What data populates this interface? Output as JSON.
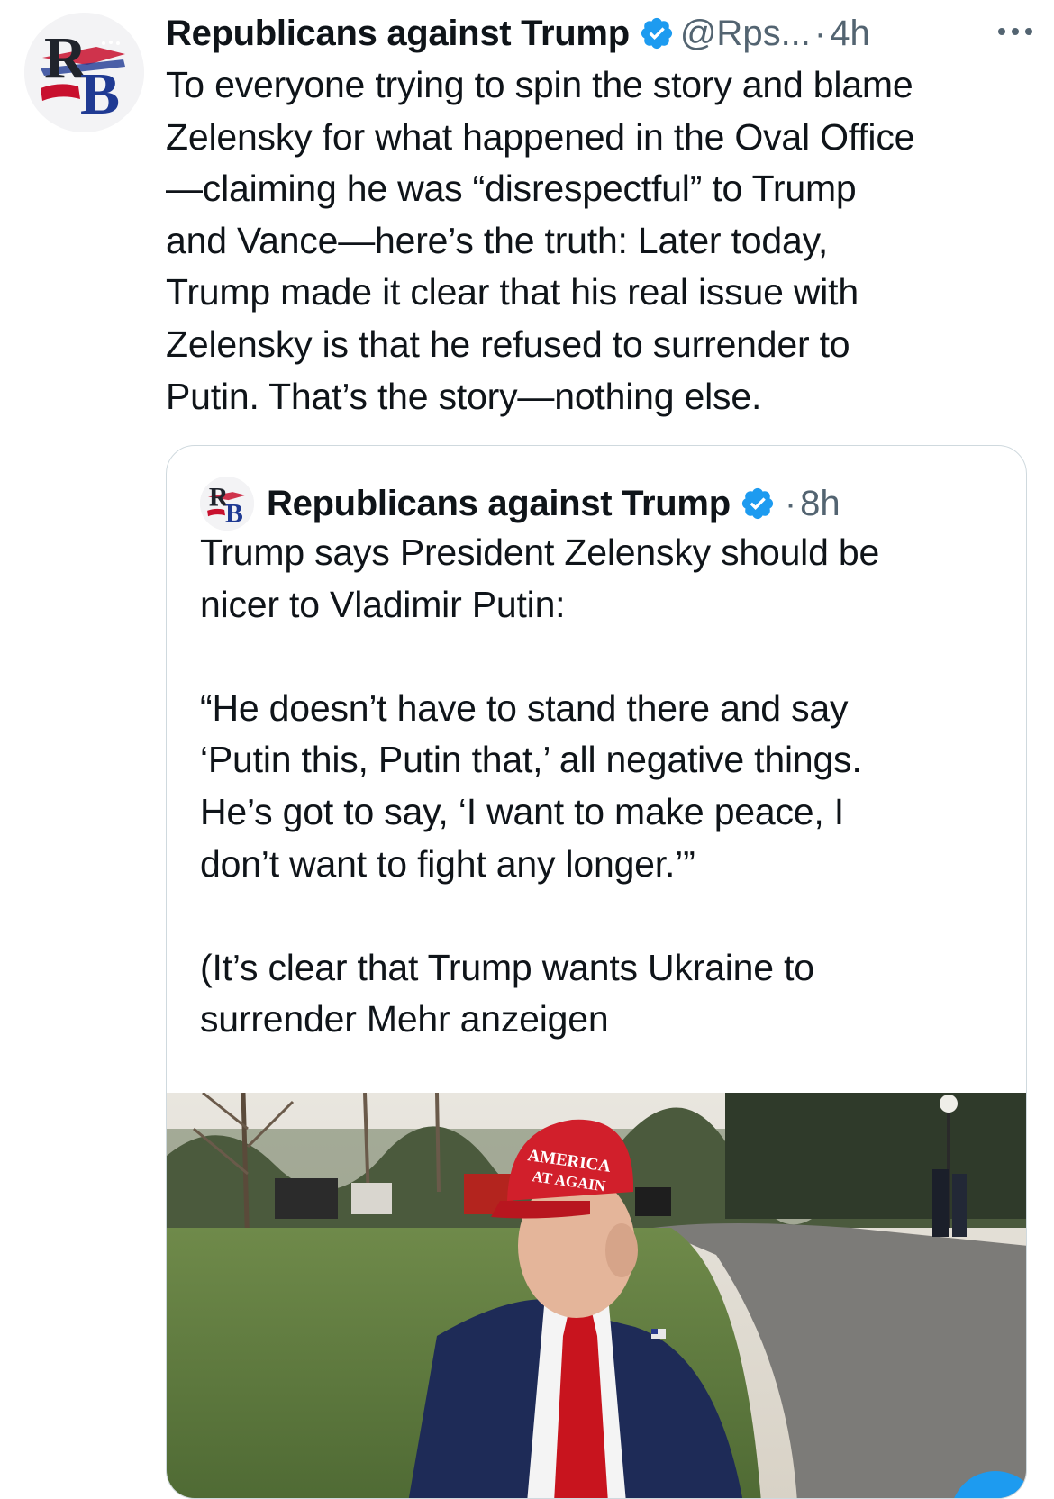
{
  "tweet": {
    "author_name": "Republicans against Trump",
    "handle": "@Rps...",
    "separator": "·",
    "time": "4h",
    "text": "To everyone trying to spin the story and blame\nZelensky for what happened in the Oval Office\n—claiming he was “disrespectful” to Trump\nand Vance—here’s the truth: Later today,\nTrump made it clear that his real issue with\nZelensky is that he refused to surrender to\nPutin. That’s the story—nothing else."
  },
  "quote": {
    "author_name": "Republicans against Trump",
    "separator": "·",
    "time": "8h",
    "text": "Trump says President Zelensky should be\nnicer to Vladimir Putin:\n\n“He doesn’t have to stand there and say\n‘Putin this, Putin that,’ all negative things.\nHe’s got to say, ‘I want to make peace, I\ndon’t want to fight any longer.’”\n\n(It’s clear that Trump wants Ukraine to\nsurrender Mehr anzeigen"
  },
  "avatar_logo": {
    "top": "R",
    "bottom": "B"
  },
  "media": {
    "hat_line1": "AMERICA",
    "hat_line2": "AT AGAIN"
  },
  "colors": {
    "verified": "#1d9bf0",
    "secondary_text": "#536471",
    "border": "#cfd9de",
    "logo_red": "#c8102e",
    "logo_blue": "#1f3a93"
  },
  "icons": {
    "verified": "verified-badge-icon",
    "more": "more-dots-icon"
  }
}
